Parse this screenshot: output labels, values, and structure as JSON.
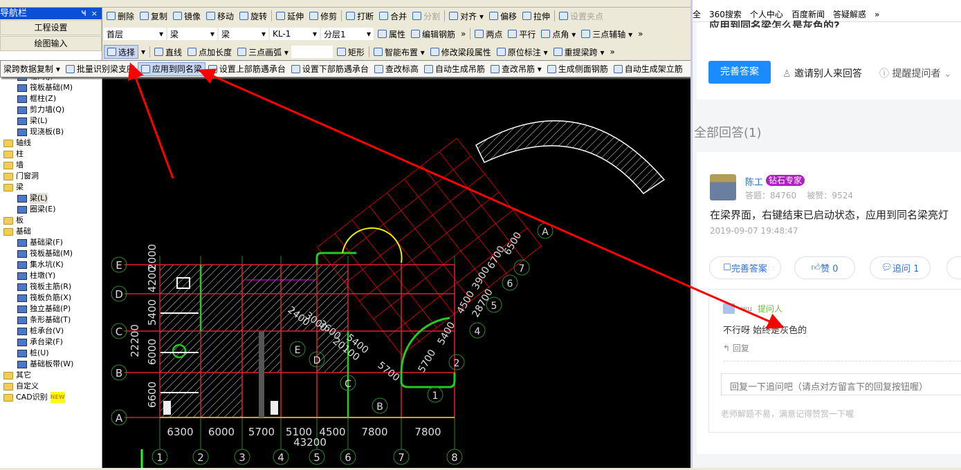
{
  "nav": {
    "title": "导航栏",
    "pin": "ꟷ",
    "close": "×",
    "buttons": [
      "工程设置",
      "绘图输入"
    ],
    "tree": [
      {
        "label": "轴网(J)",
        "lvl": 2,
        "t": "leaf"
      },
      {
        "label": "筏板基础(M)",
        "lvl": 2,
        "t": "leaf"
      },
      {
        "label": "框柱(Z)",
        "lvl": 2,
        "t": "leaf"
      },
      {
        "label": "剪力墙(Q)",
        "lvl": 2,
        "t": "leaf"
      },
      {
        "label": "梁(L)",
        "lvl": 2,
        "t": "leaf"
      },
      {
        "label": "现浇板(B)",
        "lvl": 2,
        "t": "leaf"
      },
      {
        "label": "轴线",
        "lvl": 1,
        "t": "fold"
      },
      {
        "label": "柱",
        "lvl": 1,
        "t": "fold"
      },
      {
        "label": "墙",
        "lvl": 1,
        "t": "fold"
      },
      {
        "label": "门窗洞",
        "lvl": 1,
        "t": "fold"
      },
      {
        "label": "梁",
        "lvl": 1,
        "t": "fold"
      },
      {
        "label": "梁(L)",
        "lvl": 2,
        "t": "leaf",
        "selected": true
      },
      {
        "label": "圈梁(E)",
        "lvl": 2,
        "t": "leaf"
      },
      {
        "label": "板",
        "lvl": 1,
        "t": "fold"
      },
      {
        "label": "基础",
        "lvl": 1,
        "t": "fold"
      },
      {
        "label": "基础梁(F)",
        "lvl": 2,
        "t": "leaf"
      },
      {
        "label": "筏板基础(M)",
        "lvl": 2,
        "t": "leaf"
      },
      {
        "label": "集水坑(K)",
        "lvl": 2,
        "t": "leaf"
      },
      {
        "label": "柱墩(Y)",
        "lvl": 2,
        "t": "leaf"
      },
      {
        "label": "筏板主筋(R)",
        "lvl": 2,
        "t": "leaf"
      },
      {
        "label": "筏板负筋(X)",
        "lvl": 2,
        "t": "leaf"
      },
      {
        "label": "独立基础(P)",
        "lvl": 2,
        "t": "leaf"
      },
      {
        "label": "条形基础(T)",
        "lvl": 2,
        "t": "leaf"
      },
      {
        "label": "桩承台(V)",
        "lvl": 2,
        "t": "leaf"
      },
      {
        "label": "承台梁(F)",
        "lvl": 2,
        "t": "leaf"
      },
      {
        "label": "桩(U)",
        "lvl": 2,
        "t": "leaf"
      },
      {
        "label": "基础板带(W)",
        "lvl": 2,
        "t": "leaf"
      },
      {
        "label": "其它",
        "lvl": 1,
        "t": "fold"
      },
      {
        "label": "自定义",
        "lvl": 1,
        "t": "fold"
      },
      {
        "label": "CAD识别",
        "lvl": 1,
        "t": "fold",
        "badge": "NEW"
      }
    ]
  },
  "toolbar1": [
    {
      "l": "删除"
    },
    {
      "l": "复制"
    },
    {
      "l": "镜像"
    },
    {
      "l": "移动"
    },
    {
      "l": "旋转"
    },
    {
      "sep": 1
    },
    {
      "l": "延伸"
    },
    {
      "l": "修剪"
    },
    {
      "sep": 1
    },
    {
      "l": "打断"
    },
    {
      "l": "合并"
    },
    {
      "l": "分割",
      "dis": 1
    },
    {
      "sep": 1
    },
    {
      "l": "对齐 ▾"
    },
    {
      "l": "偏移"
    },
    {
      "l": "拉伸"
    },
    {
      "sep": 1
    },
    {
      "l": "设置夹点",
      "dis": 1
    }
  ],
  "toolbar2": {
    "dropdowns": [
      "首层",
      "梁",
      "梁",
      "KL-1",
      "分层1"
    ],
    "items": [
      {
        "l": "属性"
      },
      {
        "l": "编辑钢筋"
      },
      {
        "l": "»"
      },
      {
        "sep": 1
      },
      {
        "l": "两点"
      },
      {
        "l": "平行"
      },
      {
        "l": "点角 ▾"
      },
      {
        "l": "三点辅轴 ▾"
      },
      {
        "l": "»"
      }
    ]
  },
  "toolbar3": [
    {
      "l": "选择",
      "act": 1
    },
    {
      "l": "▾"
    },
    {
      "sep": 1
    },
    {
      "l": "直线"
    },
    {
      "l": "点加长度"
    },
    {
      "l": "三点画弧 ▾"
    },
    {
      "dd": ""
    },
    {
      "l": "矩形"
    },
    {
      "sep": 1
    },
    {
      "l": "智能布置 ▾"
    },
    {
      "l": "修改梁段属性"
    },
    {
      "l": "原位标注 ▾"
    },
    {
      "l": "重提梁跨 ▾"
    },
    {
      "l": "»"
    }
  ],
  "float_toolbar": [
    {
      "l": "梁跨数据复制 ▾",
      "noicon": 1
    },
    {
      "l": "批量识别梁支座"
    },
    {
      "l": "应用到同名梁",
      "act": 1
    },
    {
      "l": "设置上部筋遇承台"
    },
    {
      "l": "设置下部筋遇承台"
    },
    {
      "l": "查改标高"
    },
    {
      "l": "自动生成吊筋"
    },
    {
      "l": "查改吊筋 ▾"
    },
    {
      "l": "生成侧面钢筋"
    },
    {
      "l": "自动生成架立筋"
    }
  ],
  "cad": {
    "rows": [
      "E",
      "D",
      "C",
      "B",
      "A"
    ],
    "cols": [
      "1",
      "2",
      "3",
      "4",
      "5",
      "6",
      "7",
      "8"
    ],
    "bottom_dims": [
      "6300",
      "6000",
      "5700",
      "5100",
      "4500",
      "7800",
      "7800"
    ],
    "total": "43200",
    "left_dims": [
      "2000",
      "4200",
      "5400",
      "6000",
      "6600"
    ],
    "left_total": "22200",
    "rot_dims": [
      "2400",
      "3000",
      "3600",
      "5400",
      "20100",
      "5700"
    ],
    "rot_axes": [
      "1",
      "2",
      "4",
      "5",
      "6",
      "7",
      "A",
      "B",
      "C",
      "D",
      "E"
    ],
    "side_dims": [
      "5700",
      "5400",
      "4500",
      "3900",
      "28700",
      "6700",
      "6500"
    ]
  },
  "web": {
    "bookmarks": [
      "全",
      "360搜索",
      "个人中心",
      "百度新闻",
      "答疑解惑",
      "»"
    ],
    "question_title_partial": "应用到同名梁怎么是灰色的?",
    "primary_btn": "完善答案",
    "invite": "邀请别人来回答",
    "remind": "提醒提问者",
    "all_answers": "全部回答(1)",
    "answer": {
      "author": "陈工",
      "badge": "钻石专家",
      "stats": "答题：84760    被赞：9524",
      "text": "在梁界面，右键结束已启动状态，应用到同名梁亮灯",
      "time": "2019-09-07 19:48:47",
      "actions": [
        "完善答案",
        "赞 0",
        "追问  1"
      ]
    },
    "followup": {
      "user": "wu",
      "role": "提问人",
      "text": "不行呀 始终是灰色的",
      "reply": "回复",
      "input_placeholder": "回复一下追问吧（请点对方留言下的回复按钮喔）",
      "tip": "老师解题不易，满意记得赞赏一下喔"
    },
    "colors": {
      "primary": "#1a8cff",
      "link": "#2f6fd6",
      "badge": "#b01ec4",
      "role": "#6abf3a"
    }
  }
}
